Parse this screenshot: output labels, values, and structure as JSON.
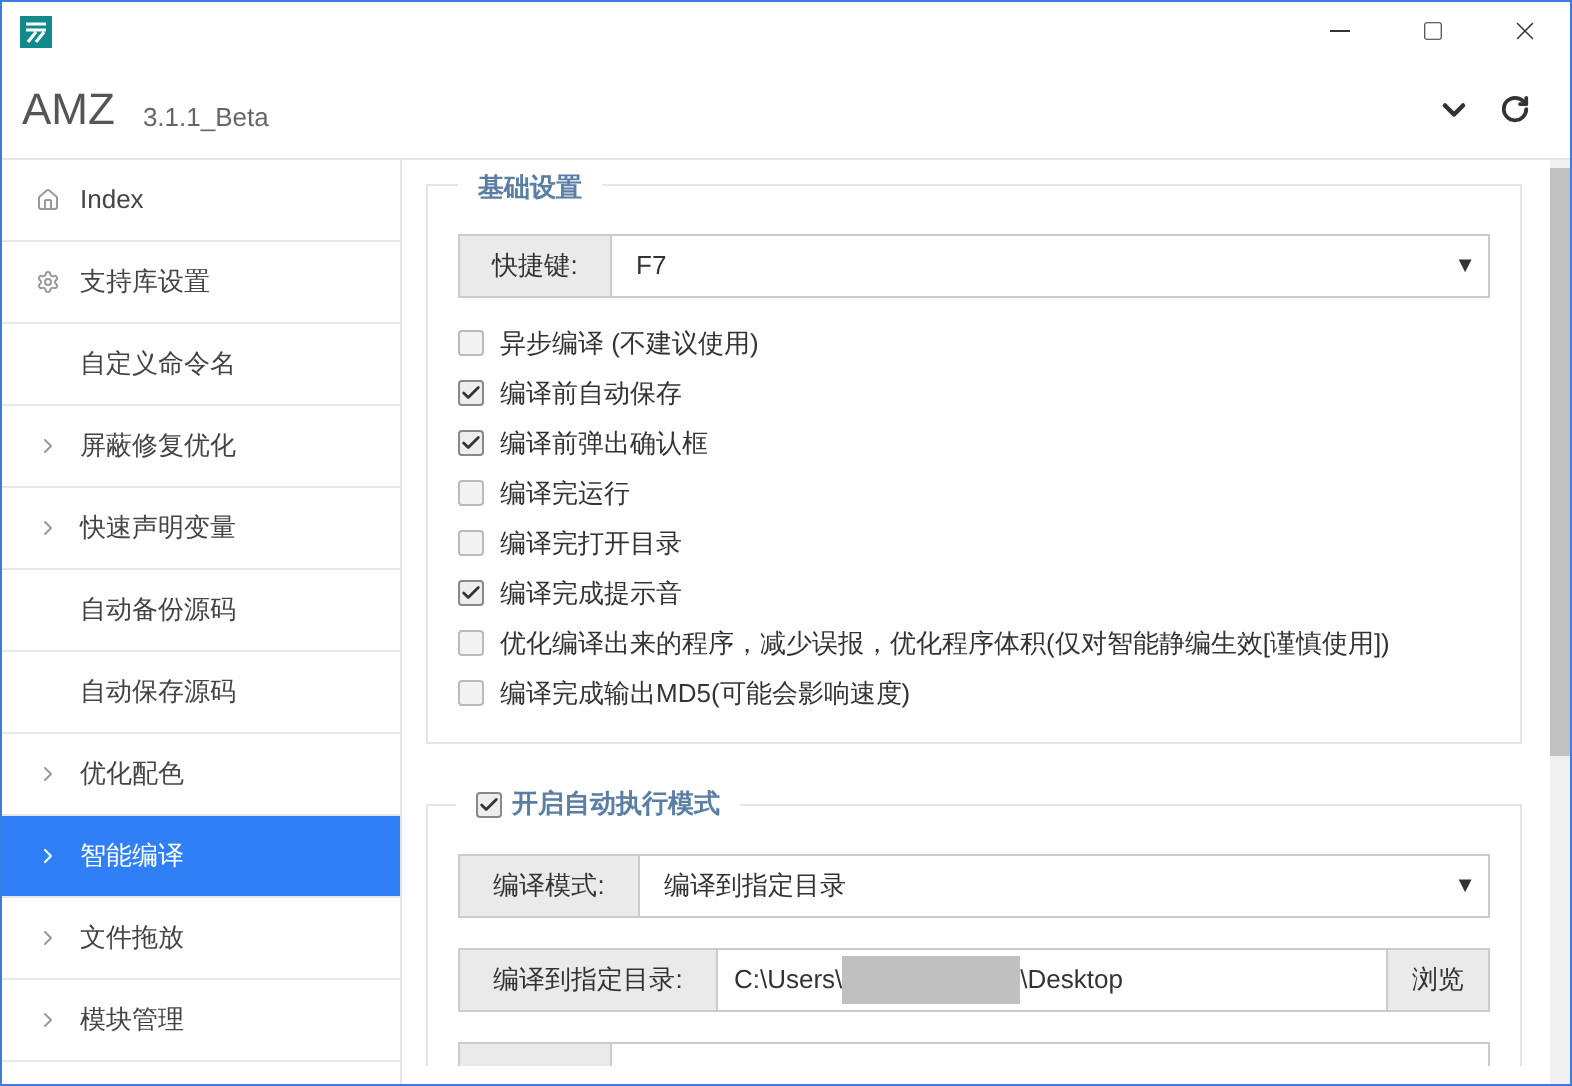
{
  "app": {
    "name": "AMZ",
    "version": "3.1.1_Beta"
  },
  "sidebar": {
    "items": [
      {
        "label": "Index",
        "kind": "home",
        "selected": false
      },
      {
        "label": "支持库设置",
        "kind": "gear",
        "selected": false
      },
      {
        "label": "自定义命令名",
        "kind": "plain",
        "selected": false
      },
      {
        "label": "屏蔽修复优化",
        "kind": "chevron",
        "selected": false
      },
      {
        "label": "快速声明变量",
        "kind": "chevron",
        "selected": false
      },
      {
        "label": "自动备份源码",
        "kind": "plain",
        "selected": false
      },
      {
        "label": "自动保存源码",
        "kind": "plain",
        "selected": false
      },
      {
        "label": "优化配色",
        "kind": "chevron",
        "selected": false
      },
      {
        "label": "智能编译",
        "kind": "chevron",
        "selected": true
      },
      {
        "label": "文件拖放",
        "kind": "chevron",
        "selected": false
      },
      {
        "label": "模块管理",
        "kind": "chevron",
        "selected": false
      }
    ]
  },
  "basic": {
    "legend": "基础设置",
    "hotkey": {
      "label": "快捷键:",
      "value": "F7",
      "arrow": "▼"
    },
    "options": [
      {
        "label": "异步编译 (不建议使用)",
        "checked": false
      },
      {
        "label": "编译前自动保存",
        "checked": true
      },
      {
        "label": "编译前弹出确认框",
        "checked": true
      },
      {
        "label": "编译完运行",
        "checked": false
      },
      {
        "label": "编译完打开目录",
        "checked": false
      },
      {
        "label": "编译完成提示音",
        "checked": true
      },
      {
        "label": "优化编译出来的程序，减少误报，优化程序体积(仅对智能静编生效[谨慎使用])",
        "checked": false
      },
      {
        "label": "编译完成输出MD5(可能会影响速度)",
        "checked": false
      }
    ]
  },
  "auto": {
    "legend": "开启自动执行模式",
    "checked": true,
    "mode": {
      "label": "编译模式:",
      "value": "编译到指定目录",
      "arrow": "▼"
    },
    "dir": {
      "label": "编译到指定目录:",
      "value_start": "C:\\Users\\",
      "value_end": "\\Desktop",
      "button": "浏览"
    }
  }
}
